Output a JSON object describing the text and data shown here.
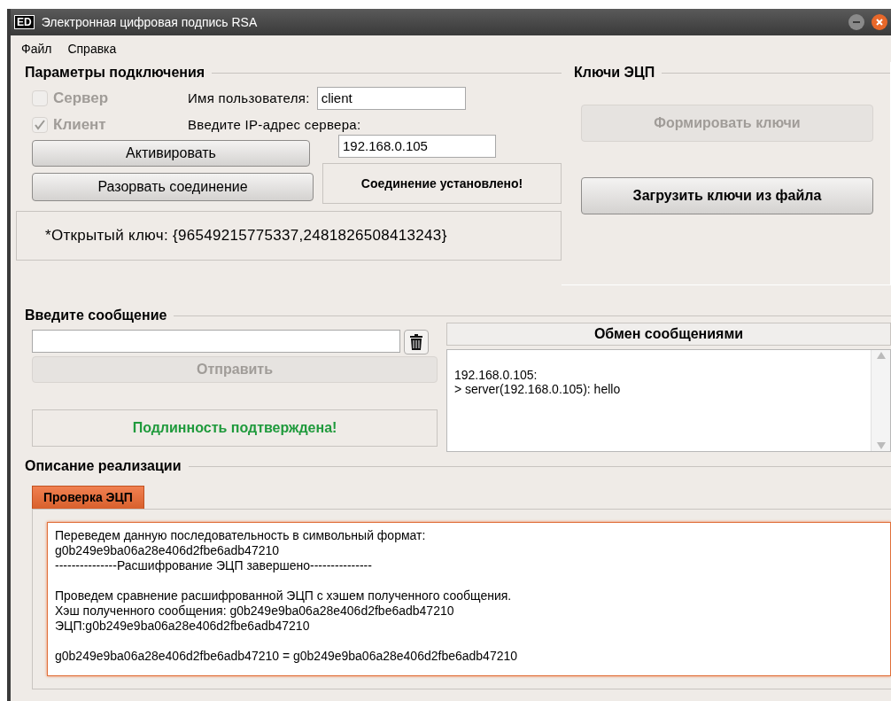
{
  "window": {
    "icon_text": "ED",
    "title": "Электронная цифровая подпись RSA"
  },
  "menu": [
    "Файл",
    "Справка"
  ],
  "connection": {
    "title": "Параметры подключения",
    "checkboxes": [
      {
        "label": "Сервер",
        "checked": false,
        "disabled": true
      },
      {
        "label": "Клиент",
        "checked": true,
        "disabled": true
      }
    ],
    "username_label": "Имя пользователя:",
    "username": "client",
    "ip_label": "Введите IP-адрес сервера:",
    "ip": "192.168.0.105",
    "activate": "Активировать",
    "disconnect": "Разорвать соединение",
    "status": "Соединение установлено!",
    "public_key": "*Открытый ключ: {96549215775337,2481826508413243}"
  },
  "keys": {
    "title": "Ключи ЭЦП",
    "buttons": [
      {
        "label": "Формировать ключи",
        "disabled": true
      },
      {
        "label": "Загрузить ключи из файла",
        "disabled": false
      }
    ]
  },
  "message": {
    "title": "Введите сообщение",
    "send": {
      "label": "Отправить",
      "disabled": true
    },
    "auth_status": "Подлинность подтверждена!"
  },
  "exchange": {
    "title": "Обмен сообщениями",
    "lines": [
      "192.168.0.105:",
      "> server(192.168.0.105): hello"
    ]
  },
  "description": {
    "title": "Описание реализации",
    "tabs": [
      {
        "label": "Проверка ЭЦП",
        "selected": true
      }
    ],
    "paragraphs": [
      [
        "Переведем данную последовательность в символьный формат:",
        "g0b249e9ba06a28e406d2fbe6adb47210",
        "---------------Расшифрование ЭЦП завершено---------------"
      ],
      [
        "Проведем сравнение расшифрованной ЭЦП с хэшем полученного сообщения.",
        "Хэш полученного сообщения: g0b249e9ba06a28e406d2fbe6adb47210",
        "ЭЦП:g0b249e9ba06a28e406d2fbe6adb47210"
      ],
      [
        "g0b249e9ba06a28e406d2fbe6adb47210 = g0b249e9ba06a28e406d2fbe6adb47210"
      ]
    ]
  }
}
